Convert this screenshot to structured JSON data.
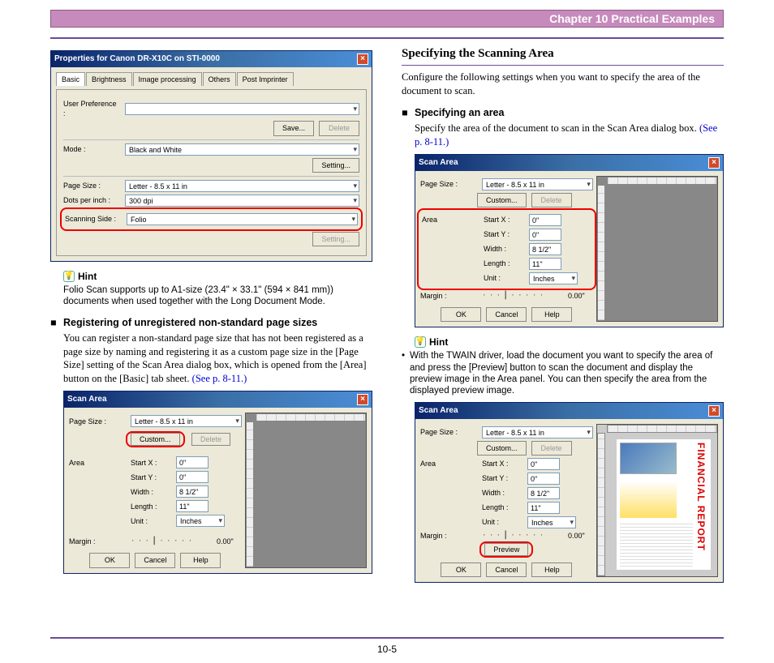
{
  "header": {
    "chapter": "Chapter 10   Practical Examples"
  },
  "left": {
    "props": {
      "title": "Properties for Canon DR-X10C on STI-0000",
      "tabs": [
        "Basic",
        "Brightness",
        "Image processing",
        "Others",
        "Post Imprinter"
      ],
      "userpref_lbl": "User Preference :",
      "save": "Save...",
      "delete": "Delete",
      "mode_lbl": "Mode :",
      "mode_val": "Black and White",
      "setting": "Setting...",
      "pagesize_lbl": "Page Size :",
      "pagesize_val": "Letter - 8.5 x 11 in",
      "dpi_lbl": "Dots per inch :",
      "dpi_val": "300 dpi",
      "side_lbl": "Scanning Side :",
      "side_val": "Folio"
    },
    "hint_label": "Hint",
    "hint": "Folio Scan supports up to A1-size (23.4\" × 33.1\" (594 × 841 mm)) documents when used together with the Long Document Mode.",
    "sub": "Registering of unregistered non-standard page sizes",
    "body": "You can register a non-standard page size that has not been registered as a page size by naming and registering it as a custom page size in the [Page Size] setting of the Scan Area dialog box, which is opened from the [Area] button on the [Basic] tab sheet.",
    "link": "(See p. 8-11.)",
    "scan": {
      "title": "Scan Area",
      "pagesize_lbl": "Page Size :",
      "pagesize_val": "Letter - 8.5 x 11 in",
      "custom": "Custom...",
      "delete": "Delete",
      "area_lbl": "Area",
      "sx_lbl": "Start X :",
      "sx_val": "0\"",
      "sy_lbl": "Start Y :",
      "sy_val": "0\"",
      "w_lbl": "Width :",
      "w_val": "8 1/2\"",
      "l_lbl": "Length :",
      "l_val": "11\"",
      "u_lbl": "Unit :",
      "u_val": "Inches",
      "margin_lbl": "Margin :",
      "margin_val": "0.00\"",
      "ok": "OK",
      "cancel": "Cancel",
      "help": "Help"
    }
  },
  "right": {
    "h2": "Specifying the Scanning Area",
    "intro": "Configure the following settings when you want to specify the area of the document to scan.",
    "sub": "Specifying an area",
    "body": "Specify the area of the document to scan in the Scan Area dialog box.",
    "link": "(See p. 8-11.)",
    "hint_label": "Hint",
    "hint": "With the TWAIN driver, load the document you want to specify the area of and press the [Preview] button to scan the document and display the preview image in the Area panel. You can then specify the area from the displayed preview image.",
    "scan": {
      "title": "Scan Area",
      "pagesize_lbl": "Page Size :",
      "pagesize_val": "Letter - 8.5 x 11 in",
      "custom": "Custom...",
      "delete": "Delete",
      "area_lbl": "Area",
      "sx_lbl": "Start X :",
      "sx_val": "0\"",
      "sy_lbl": "Start Y :",
      "sy_val": "0\"",
      "w_lbl": "Width :",
      "w_val": "8 1/2\"",
      "l_lbl": "Length :",
      "l_val": "11\"",
      "u_lbl": "Unit :",
      "u_val": "Inches",
      "margin_lbl": "Margin :",
      "margin_val": "0.00\"",
      "preview": "Preview",
      "ok": "OK",
      "cancel": "Cancel",
      "help": "Help"
    },
    "fin_title": "FINANCIAL REPORT"
  },
  "pageno": "10-5"
}
